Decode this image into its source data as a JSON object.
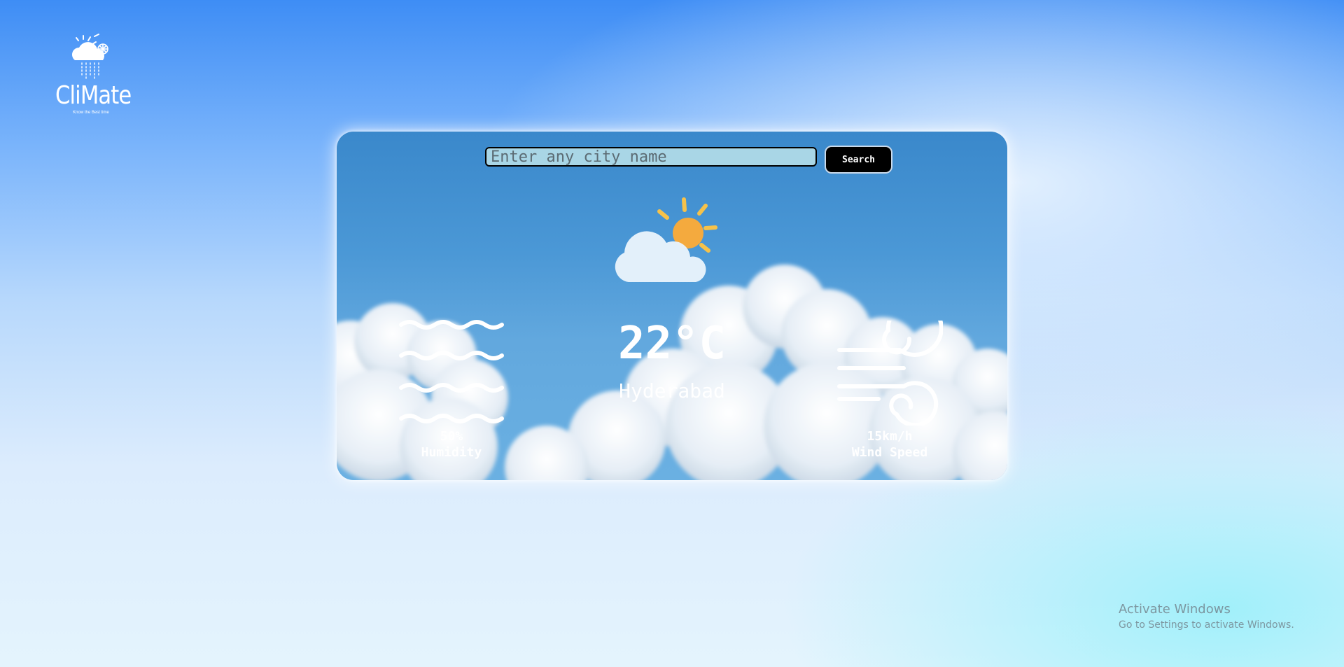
{
  "logo": {
    "name": "CliMate",
    "tagline": "Know the Best time",
    "icon": "cloud-sun-rain-icon"
  },
  "search": {
    "placeholder": "Enter any city name",
    "value": "",
    "button_label": "Search"
  },
  "weather": {
    "icon": "partly-cloudy-icon",
    "temperature": "22°C",
    "city": "Hyderabad"
  },
  "humidity": {
    "icon": "humidity-waves-icon",
    "value": "50%",
    "label": "Humidity"
  },
  "wind": {
    "icon": "wind-icon",
    "value": "15km/h",
    "label": "Wind Speed"
  },
  "watermark": {
    "title": "Activate Windows",
    "subtitle": "Go to Settings to activate Windows."
  },
  "colors": {
    "sun": "#f4aa3e",
    "sun_rays": "#f6c24a",
    "cloud": "#e8f3fb",
    "search_input_bg": "#a9d6e6",
    "search_button_bg": "#000000"
  }
}
